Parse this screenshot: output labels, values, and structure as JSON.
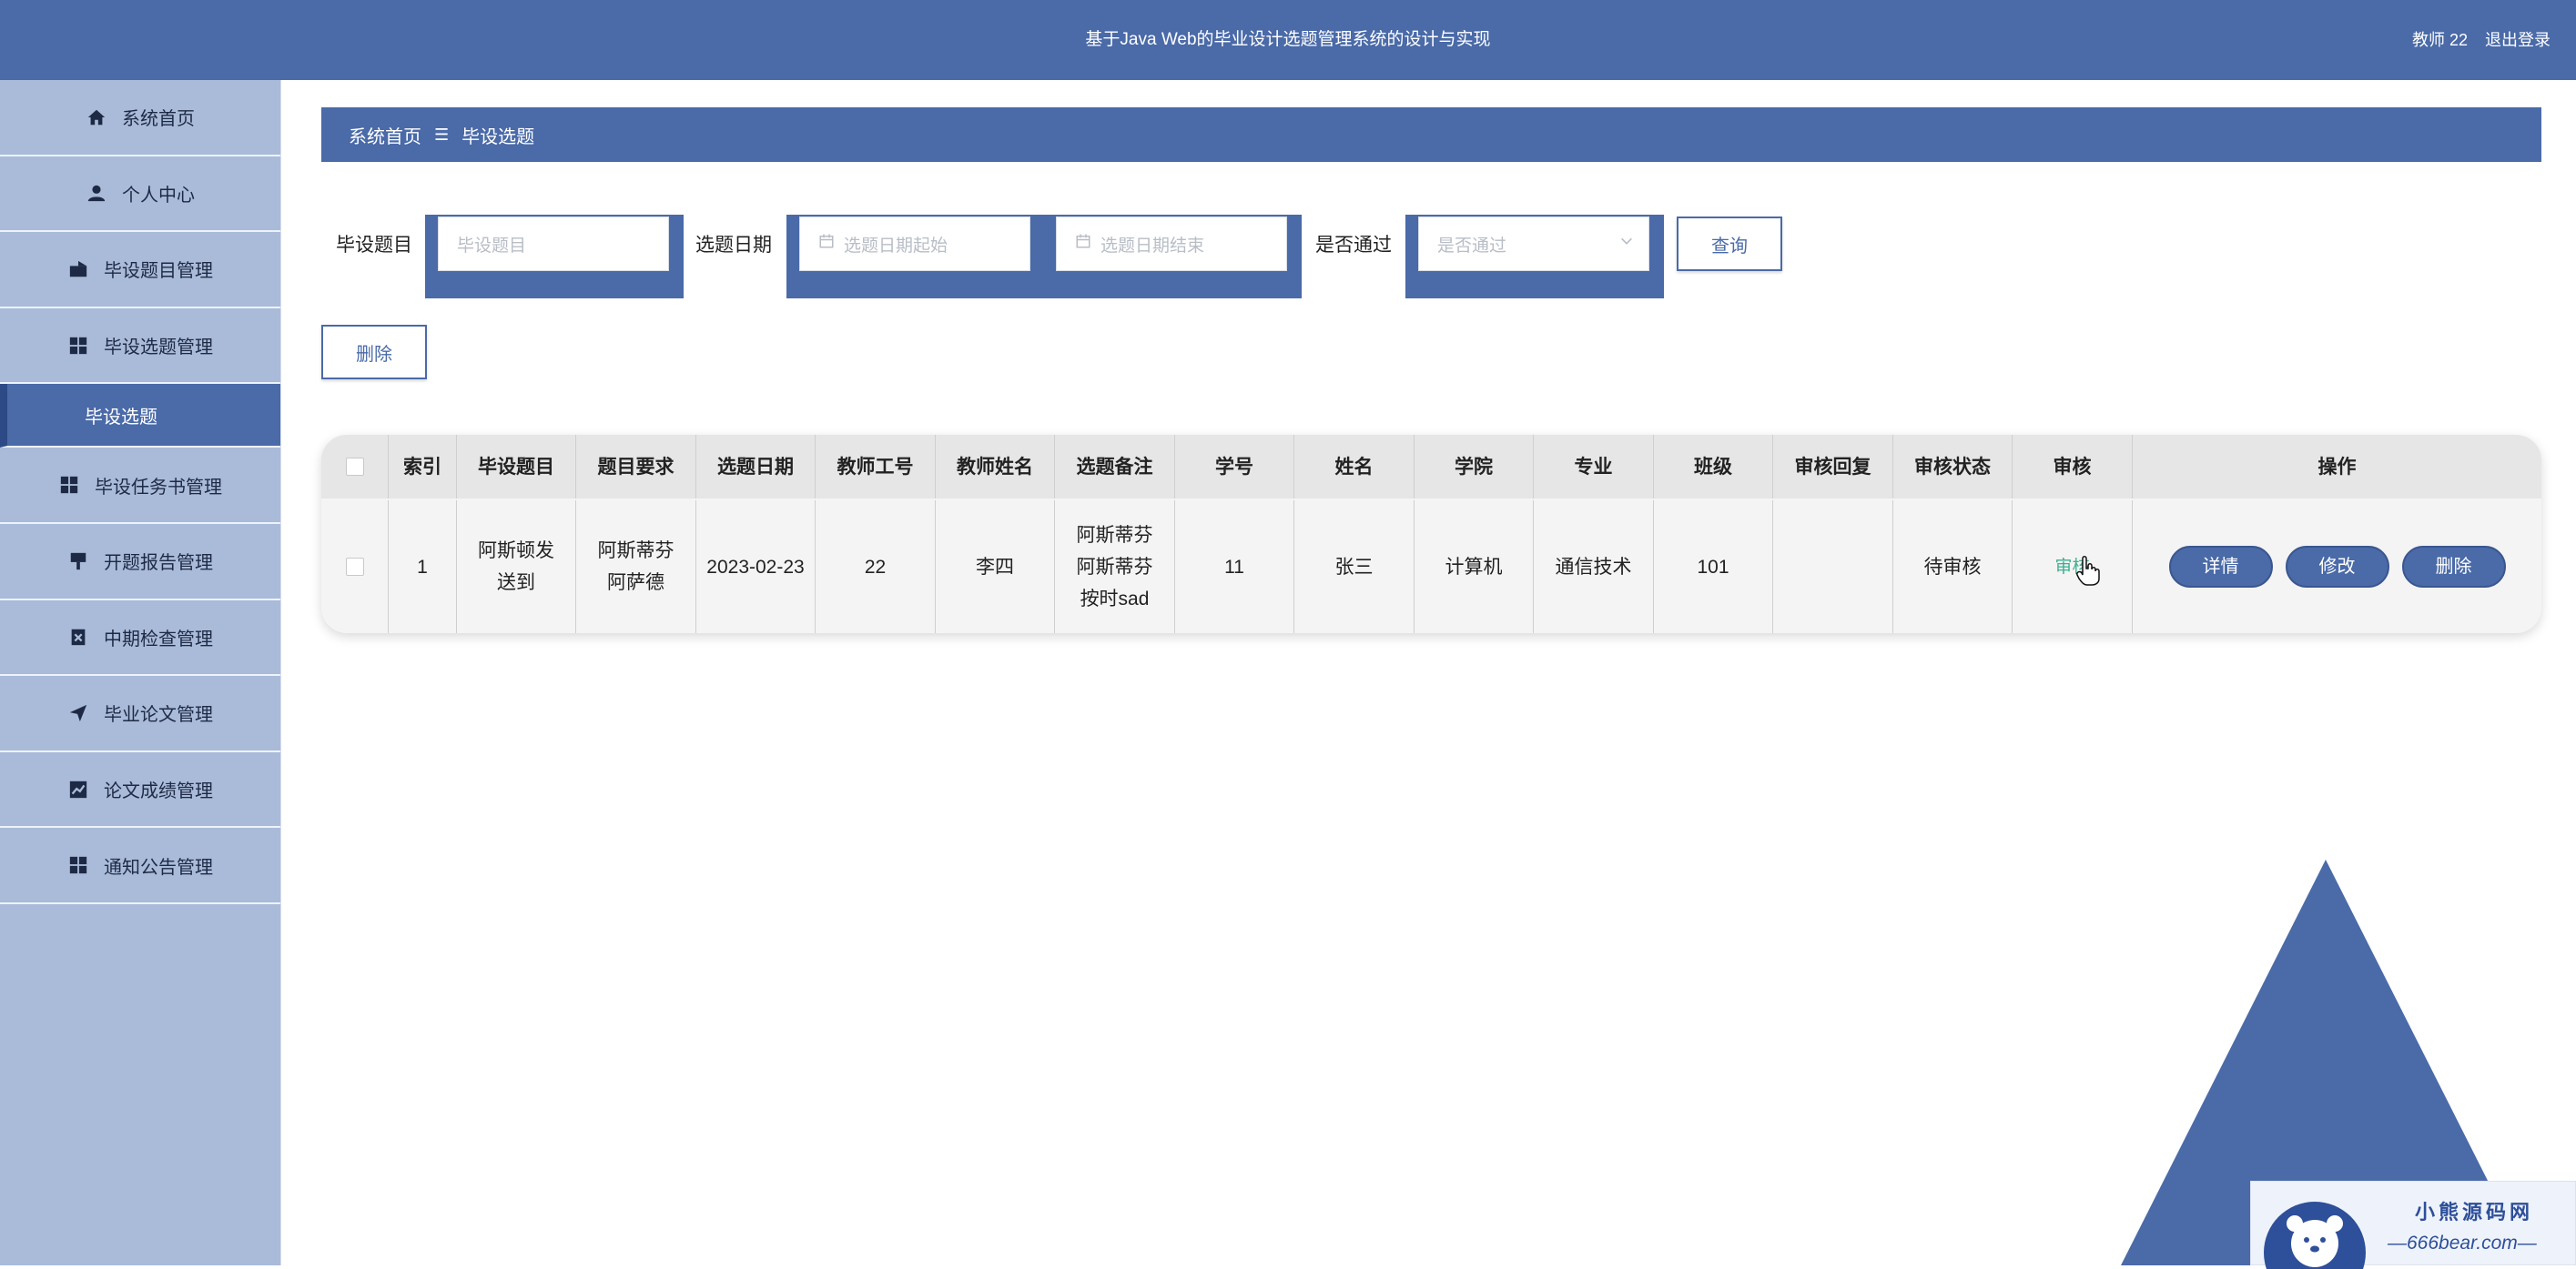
{
  "header": {
    "title": "基于Java Web的毕业设计选题管理系统的设计与实现",
    "user": "教师 22",
    "logout": "退出登录",
    "color": "#4a6aa8"
  },
  "sidebar": {
    "items": [
      {
        "label": "系统首页",
        "icon": "home-icon"
      },
      {
        "label": "个人中心",
        "icon": "user-icon"
      },
      {
        "label": "毕设题目管理",
        "icon": "folder-icon"
      },
      {
        "label": "毕设选题管理",
        "icon": "grid-icon"
      },
      {
        "label": "毕设选题",
        "icon": "",
        "active": true
      },
      {
        "label": "毕设任务书管理",
        "icon": "grid-icon"
      },
      {
        "label": "开题报告管理",
        "icon": "flag-icon"
      },
      {
        "label": "中期检查管理",
        "icon": "clipboard-icon"
      },
      {
        "label": "毕业论文管理",
        "icon": "send-icon"
      },
      {
        "label": "论文成绩管理",
        "icon": "chart-icon"
      },
      {
        "label": "通知公告管理",
        "icon": "grid-icon"
      }
    ]
  },
  "breadcrumb": {
    "home": "系统首页",
    "sep": "☰",
    "current": "毕设选题"
  },
  "search": {
    "topic_label": "毕设题目",
    "topic_placeholder": "毕设题目",
    "date_label": "选题日期",
    "date_start_placeholder": "选题日期起始",
    "date_end_placeholder": "选题日期结束",
    "pass_label": "是否通过",
    "pass_placeholder": "是否通过",
    "query_button": "查询",
    "delete_button": "删除"
  },
  "table": {
    "headers": [
      "",
      "索引",
      "毕设题目",
      "题目要求",
      "选题日期",
      "教师工号",
      "教师姓名",
      "选题备注",
      "学号",
      "姓名",
      "学院",
      "专业",
      "班级",
      "审核回复",
      "审核状态",
      "审核",
      "操作"
    ],
    "rows": [
      {
        "index": "1",
        "topic": "阿斯顿发送到",
        "requirement": "阿斯蒂芬阿萨德",
        "date": "2023-02-23",
        "teacher_id": "22",
        "teacher_name": "李四",
        "remark": "阿斯蒂芬阿斯蒂芬按时sad",
        "student_id": "11",
        "student_name": "张三",
        "college": "计算机",
        "major": "通信技术",
        "class": "101",
        "reply": "",
        "status": "待审核",
        "audit": "审核",
        "actions": [
          "详情",
          "修改",
          "删除"
        ]
      }
    ]
  },
  "watermark": {
    "line1": "小熊源码网",
    "line2": "—666bear.com—"
  }
}
